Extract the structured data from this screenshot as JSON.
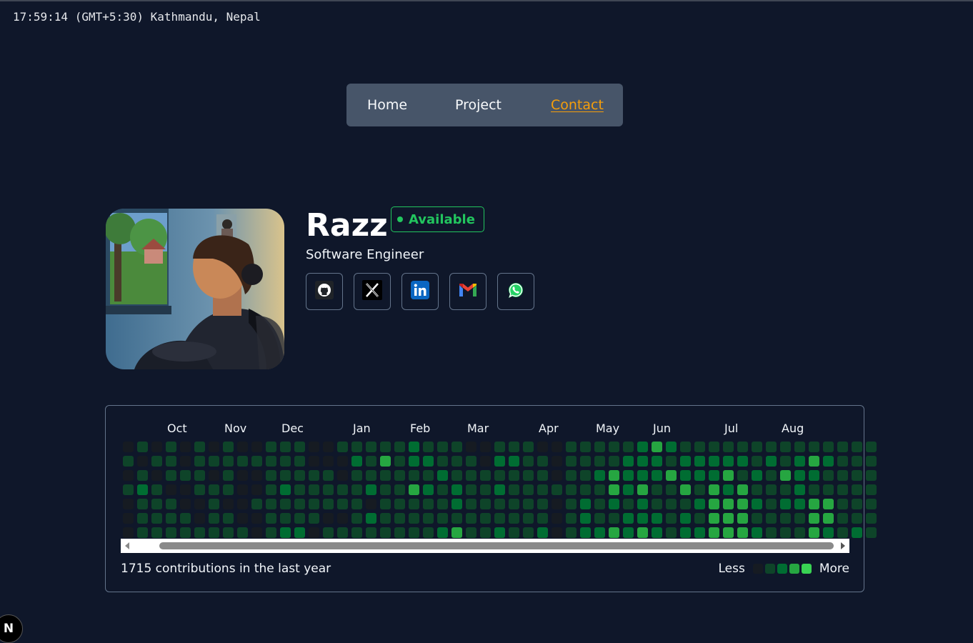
{
  "clock": {
    "text": "17:59:14 (GMT+5:30) Kathmandu, Nepal"
  },
  "nav": {
    "items": [
      {
        "label": "Home",
        "active": false
      },
      {
        "label": "Project",
        "active": false
      },
      {
        "label": "Contact",
        "active": true
      }
    ]
  },
  "profile": {
    "name": "Razz",
    "status": "Available",
    "role": "Software Engineer",
    "socials": [
      {
        "icon": "github-icon"
      },
      {
        "icon": "x-icon"
      },
      {
        "icon": "linkedin-icon"
      },
      {
        "icon": "gmail-icon"
      },
      {
        "icon": "whatsapp-icon"
      }
    ]
  },
  "contributions": {
    "months": [
      "Oct",
      "Nov",
      "Dec",
      "Jan",
      "Feb",
      "Mar",
      "Apr",
      "May",
      "Jun",
      "Jul",
      "Aug"
    ],
    "summary": "1715 contributions in the last year",
    "legend_less": "Less",
    "legend_more": "More",
    "colors": [
      "#161b22",
      "#0e4429",
      "#006d32",
      "#26a641",
      "#39d353"
    ],
    "weeks": [
      "0101000",
      "1012111",
      "0101111",
      "1110111",
      "0010011",
      "1111001",
      "0101111",
      "1111011",
      "0100001",
      "0100100",
      "1111111",
      "1112112",
      "1111112",
      "0011110",
      "0011101",
      "1001101",
      "1211111",
      "1112021",
      "1311111",
      "1111111",
      "2213111",
      "1212111",
      "1121112",
      "1112213",
      "0111111",
      "0011111",
      "1212112",
      "1211111",
      "1111111",
      "0111112",
      "0001000",
      "1111111",
      "1111222",
      "1121112",
      "1133213",
      "1222122",
      "2223223",
      "3221122",
      "2131111",
      "1223122",
      "1221212",
      "1223333",
      "1232333",
      "1213333",
      "1121212",
      "1211111",
      "1131211",
      "1222211",
      "1321333",
      "1211332",
      "1111111",
      "1111112",
      "1111111"
    ]
  }
}
